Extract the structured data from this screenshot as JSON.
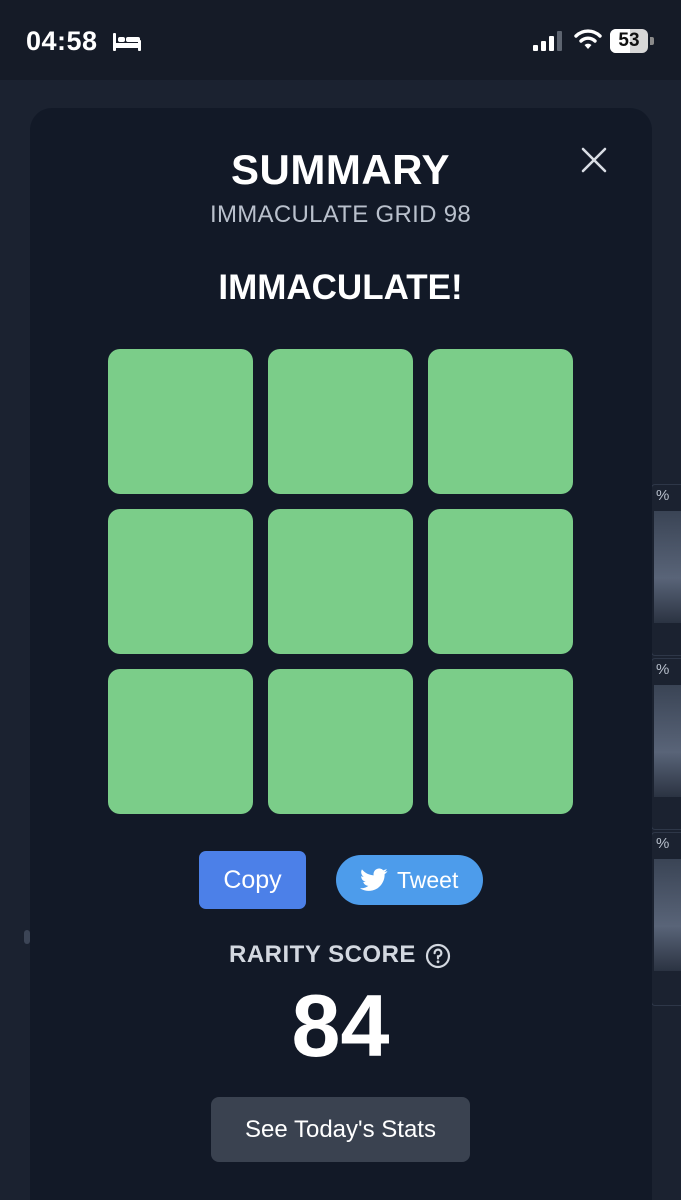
{
  "status_bar": {
    "time": "04:58",
    "sleep_icon": "bed-icon",
    "signal_icon": "cellular-signal-icon",
    "wifi_icon": "wifi-icon",
    "battery_level": "53",
    "battery_fraction": 0.53
  },
  "background": {
    "card_pct": [
      "%",
      "%",
      "%"
    ]
  },
  "modal": {
    "title": "SUMMARY",
    "subtitle": "IMMACULATE GRID 98",
    "result": "IMMACULATE!",
    "close_icon": "close-icon",
    "grid": {
      "rows": 3,
      "cols": 3,
      "cells": [
        "correct",
        "correct",
        "correct",
        "correct",
        "correct",
        "correct",
        "correct",
        "correct",
        "correct"
      ],
      "correct_color": "#7bcd89"
    },
    "copy_label": "Copy",
    "tweet_label": "Tweet",
    "tweet_icon": "twitter-bird-icon",
    "rarity_label": "RARITY SCORE",
    "help_icon": "question-circle-icon",
    "rarity_score": "84",
    "stats_label": "See Today's Stats"
  },
  "colors": {
    "background": "#1b2230",
    "modal": "#121927",
    "copy_button": "#4c80e8",
    "tweet_button": "#4d9ceb",
    "stats_button": "#3a4250"
  }
}
